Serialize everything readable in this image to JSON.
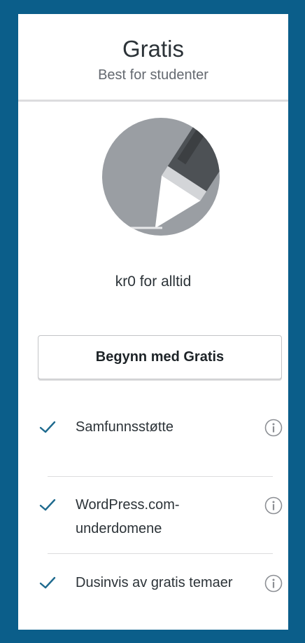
{
  "plan": {
    "name": "Gratis",
    "subtitle": "Best for studenter",
    "icon": "pencil-icon",
    "price": "kr0 for alltid",
    "cta_label": "Begynn med Gratis"
  },
  "features": [
    {
      "label": "Samfunnsstøtte",
      "icon": "check-icon",
      "info_icon": "info-icon"
    },
    {
      "label": "WordPress.com-underdomene",
      "icon": "check-icon",
      "info_icon": "info-icon"
    },
    {
      "label": "Dusinvis av gratis temaer",
      "icon": "check-icon",
      "info_icon": "info-icon"
    }
  ],
  "colors": {
    "frame": "#0b5e8a",
    "accent": "#1e6a8e",
    "text": "#2c3338",
    "muted": "#646970"
  }
}
